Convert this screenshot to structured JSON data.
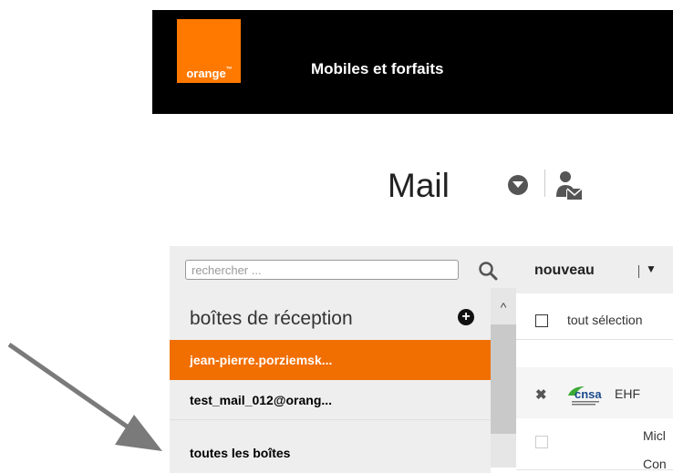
{
  "header": {
    "logo_text": "orange",
    "logo_tm": "™",
    "nav_link": "Mobiles et forfaits"
  },
  "mail": {
    "title": "Mail"
  },
  "sidebar": {
    "search_placeholder": "rechercher ...",
    "inbox_header": "boîtes de réception",
    "mailboxes": [
      {
        "label": "jean-pierre.porziemsk...",
        "active": true
      },
      {
        "label": "test_mail_012@orang..."
      },
      {
        "label": "toutes les boîtes"
      }
    ]
  },
  "toolbar": {
    "new_label": "nouveau",
    "select_all": "tout sélection"
  },
  "messages": [
    {
      "sender": "EHF",
      "logo": "cnsa"
    },
    {
      "sender": "Micl"
    },
    {
      "sender": "Con"
    }
  ],
  "colors": {
    "brand": "#ff7900",
    "active_mailbox": "#f16e00"
  }
}
